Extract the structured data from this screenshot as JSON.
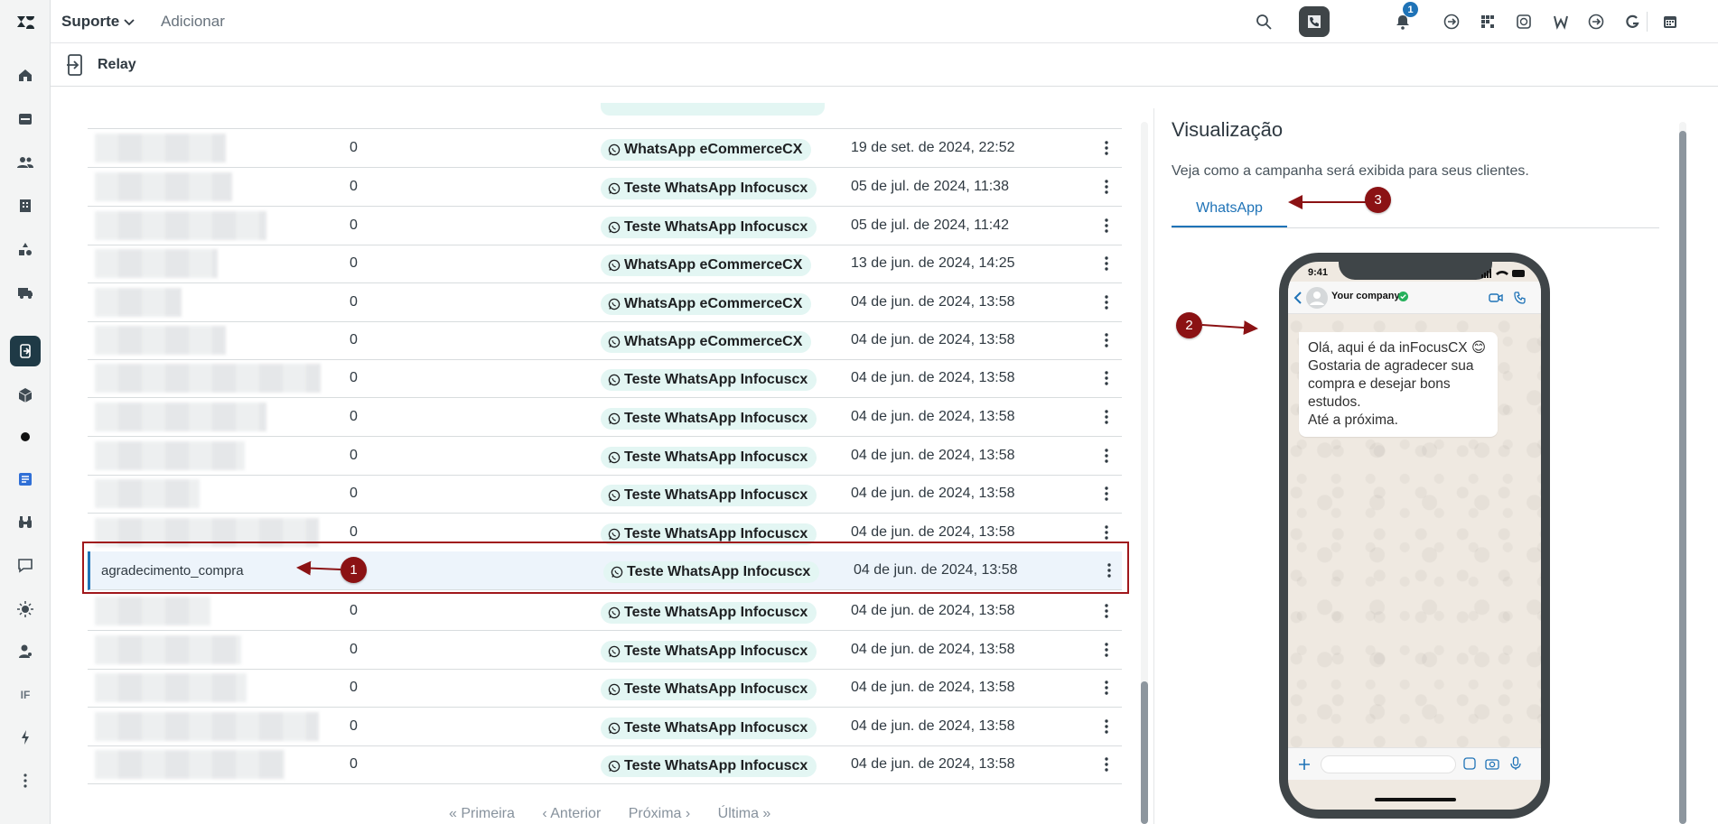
{
  "topbar": {
    "brand": "Suporte",
    "add_label": "Adicionar",
    "notification_count": "1"
  },
  "subheader": {
    "title": "Relay"
  },
  "table": {
    "rows": [
      {
        "name": "",
        "count": "0",
        "channel": "WhatsApp eCommerceCX",
        "date": "19 de set. de 2024, 22:52"
      },
      {
        "name": "",
        "count": "0",
        "channel": "Teste WhatsApp Infocuscx",
        "date": "05 de jul. de 2024, 11:38"
      },
      {
        "name": "",
        "count": "0",
        "channel": "Teste WhatsApp Infocuscx",
        "date": "05 de jul. de 2024, 11:42"
      },
      {
        "name": "",
        "count": "0",
        "channel": "WhatsApp eCommerceCX",
        "date": "13 de jun. de 2024, 14:25"
      },
      {
        "name": "",
        "count": "0",
        "channel": "WhatsApp eCommerceCX",
        "date": "04 de jun. de 2024, 13:58"
      },
      {
        "name": "",
        "count": "0",
        "channel": "WhatsApp eCommerceCX",
        "date": "04 de jun. de 2024, 13:58"
      },
      {
        "name": "",
        "count": "0",
        "channel": "Teste WhatsApp Infocuscx",
        "date": "04 de jun. de 2024, 13:58"
      },
      {
        "name": "",
        "count": "0",
        "channel": "Teste WhatsApp Infocuscx",
        "date": "04 de jun. de 2024, 13:58"
      },
      {
        "name": "",
        "count": "0",
        "channel": "Teste WhatsApp Infocuscx",
        "date": "04 de jun. de 2024, 13:58"
      },
      {
        "name": "",
        "count": "0",
        "channel": "Teste WhatsApp Infocuscx",
        "date": "04 de jun. de 2024, 13:58"
      },
      {
        "name": "",
        "count": "0",
        "channel": "Teste WhatsApp Infocuscx",
        "date": "04 de jun. de 2024, 13:58"
      },
      {
        "name": "agradecimento_compra",
        "count": "",
        "channel": "Teste WhatsApp Infocuscx",
        "date": "04 de jun. de 2024, 13:58"
      },
      {
        "name": "",
        "count": "0",
        "channel": "Teste WhatsApp Infocuscx",
        "date": "04 de jun. de 2024, 13:58"
      },
      {
        "name": "",
        "count": "0",
        "channel": "Teste WhatsApp Infocuscx",
        "date": "04 de jun. de 2024, 13:58"
      },
      {
        "name": "",
        "count": "0",
        "channel": "Teste WhatsApp Infocuscx",
        "date": "04 de jun. de 2024, 13:58"
      },
      {
        "name": "",
        "count": "0",
        "channel": "Teste WhatsApp Infocuscx",
        "date": "04 de jun. de 2024, 13:58"
      },
      {
        "name": "",
        "count": "0",
        "channel": "Teste WhatsApp Infocuscx",
        "date": "04 de jun. de 2024, 13:58"
      }
    ],
    "selected_index": 11
  },
  "pagination": {
    "first": "« Primeira",
    "prev": "‹ Anterior",
    "next": "Próxima ›",
    "last": "Última »"
  },
  "preview": {
    "title": "Visualização",
    "description": "Veja como a campanha será exibida para seus clientes.",
    "tab_label": "WhatsApp",
    "phone": {
      "time": "9:41",
      "contact_name": "Your company",
      "message_lines": [
        "Olá, aqui é da inFocusCX 😊",
        "Gostaria de agradecer sua",
        "compra e desejar bons",
        "estudos.",
        "Até a próxima."
      ]
    }
  },
  "annotations": [
    "1",
    "2",
    "3"
  ],
  "colors": {
    "accent": "#1f73b7",
    "annotation": "#8b1214",
    "pill_bg": "#e3f6f3",
    "rail_active": "#1f3a46"
  },
  "icons": {
    "rail": [
      "home-icon",
      "inbox-icon",
      "users-icon",
      "building-icon",
      "shapes-icon",
      "truck-icon",
      "relay-icon",
      "cube-icon",
      "dot-icon",
      "app-icon",
      "binoculars-icon",
      "chat-icon",
      "sun-icon",
      "person-icon",
      "if-icon",
      "bolt-icon",
      "more-icon"
    ],
    "topbar": [
      "search-icon",
      "phone-icon",
      "bell-icon",
      "apps-icons",
      "close-icon"
    ]
  }
}
